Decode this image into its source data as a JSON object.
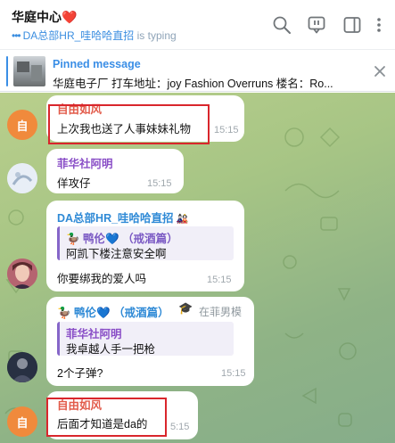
{
  "header": {
    "title": "华庭中心",
    "heart": "❤️",
    "typing_user": "DA总部HR_哇哈哈直招",
    "typing_verb": "is typing"
  },
  "icons": [
    "search-icon",
    "comment-icon",
    "sidebar-toggle-icon",
    "more-icon",
    "close-icon",
    "pin-thumbnail"
  ],
  "pinned": {
    "title": "Pinned message",
    "text": "华庭电子厂 打车地址：joy Fashion  Overruns   楼名：Ro..."
  },
  "messages": [
    {
      "sender": "自由如风",
      "text": "上次我也送了人事妹妹礼物",
      "time": "15:15",
      "avatar": "自"
    },
    {
      "sender": "菲华社阿明",
      "text": "佯攻仔",
      "time": "15:15"
    },
    {
      "sender": "DA总部HR_哇哈哈直招",
      "quote_name": "🦆 鸭伦💙 （戒酒篇）",
      "quote_text": "阿凯下楼注意安全啊",
      "text": "你要绑我的爱人吗",
      "time": "15:15"
    },
    {
      "sender": "🦆 鸭伦💙 （戒酒篇）",
      "sender_tag": "在菲男模",
      "quote_name": "菲华社阿明",
      "quote_text": "我卓越人手一把枪",
      "text": "2个子弹?",
      "time": "15:15"
    },
    {
      "sender": "自由如风",
      "text": "后面才知道是da的",
      "time": "5:15",
      "avatar": "自"
    }
  ],
  "colors": {
    "accent_blue": "#3a8ee6",
    "sender_red": "#e25b4a",
    "sender_purple": "#8a4fc7",
    "sender_blue": "#2f8ad6",
    "sender_green": "#3aa056",
    "highlight_red": "#d9262c"
  }
}
